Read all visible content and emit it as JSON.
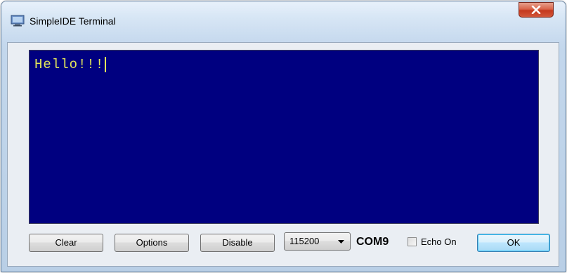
{
  "window": {
    "title": "SimpleIDE Terminal",
    "close_icon": "close-x-icon",
    "app_icon": "terminal-window-icon"
  },
  "terminal": {
    "output": "Hello!!!",
    "background_color": "#000080",
    "text_color": "#e3e65a"
  },
  "controls": {
    "clear_label": "Clear",
    "options_label": "Options",
    "disable_label": "Disable",
    "baud_rate": "115200",
    "port": "COM9",
    "echo_label": "Echo On",
    "echo_checked": false,
    "ok_label": "OK"
  }
}
